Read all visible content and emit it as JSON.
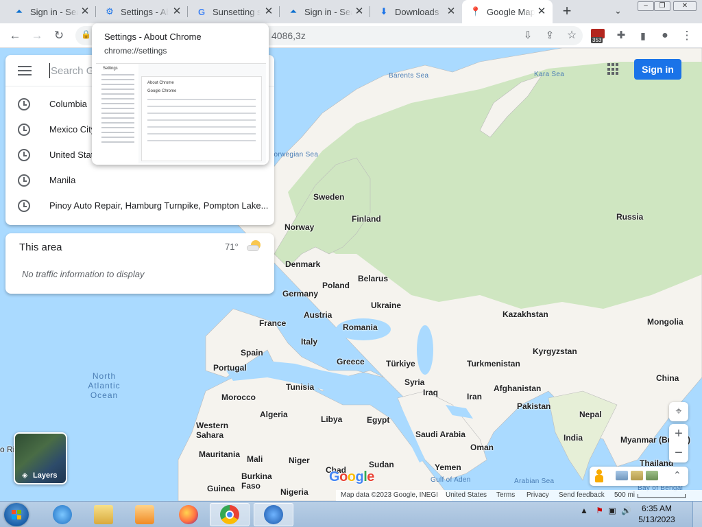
{
  "browser": {
    "tabs": [
      {
        "title": "Sign in - Sea",
        "icon": "azure-icon"
      },
      {
        "title": "Settings - Ab",
        "icon": "settings-gear-icon"
      },
      {
        "title": "Sunsetting su",
        "icon": "google-icon"
      },
      {
        "title": "Sign in - Sea",
        "icon": "azure-icon"
      },
      {
        "title": "Downloads",
        "icon": "download-icon"
      },
      {
        "title": "Google Map",
        "icon": "google-maps-icon"
      }
    ],
    "omnibox_url_fragment": "4086,3z",
    "extension_badge": "353"
  },
  "hovercard": {
    "title": "Settings - About Chrome",
    "url": "chrome://settings",
    "preview_heading": "Settings",
    "preview_section": "About Chrome",
    "preview_product": "Google Chrome"
  },
  "maps": {
    "search_placeholder": "Search Google Maps",
    "history": [
      "Columbia",
      "Mexico City",
      "United States",
      "Manila",
      "Pinoy Auto Repair, Hamburg Turnpike, Pompton Lake..."
    ],
    "area": {
      "title": "This area",
      "temperature": "71°",
      "message": "No traffic information to display"
    },
    "signin_label": "Sign in",
    "layers_label": "Layers",
    "logo": "Google",
    "attribution": {
      "data": "Map data ©2023 Google, INEGI",
      "region": "United States",
      "terms": "Terms",
      "privacy": "Privacy",
      "feedback": "Send feedback",
      "scale": "500 mi"
    },
    "places": {
      "russia": "Russia",
      "sweden": "Sweden",
      "finland": "Finland",
      "norway": "Norway",
      "denmark": "Denmark",
      "poland": "Poland",
      "belarus": "Belarus",
      "germany": "Germany",
      "ukraine": "Ukraine",
      "france": "France",
      "austria": "Austria",
      "romania": "Romania",
      "kazakhstan": "Kazakhstan",
      "mongolia": "Mongolia",
      "italy": "Italy",
      "spain": "Spain",
      "portugal": "Portugal",
      "greece": "Greece",
      "turkiye": "Türkiye",
      "turkmenistan": "Turkmenistan",
      "kyrgyzstan": "Kyrgyzstan",
      "china": "China",
      "syria": "Syria",
      "iraq": "Iraq",
      "iran": "Iran",
      "afghanistan": "Afghanistan",
      "pakistan": "Pakistan",
      "nepal": "Nepal",
      "india": "India",
      "myanmar": "Myanmar (Burma)",
      "thailand": "Thailand",
      "tunisia": "Tunisia",
      "morocco": "Morocco",
      "algeria": "Algeria",
      "libya": "Libya",
      "egypt": "Egypt",
      "saudi": "Saudi Arabia",
      "oman": "Oman",
      "yemen": "Yemen",
      "western_sahara": "Western Sahara",
      "mauritania": "Mauritania",
      "mali": "Mali",
      "niger": "Niger",
      "chad": "Chad",
      "sudan": "Sudan",
      "burkina": "Burkina Faso",
      "guinea": "Guinea",
      "nigeria": "Nigeria"
    },
    "seas": {
      "barents": "Barents Sea",
      "kara": "Kara Sea",
      "norwegian": "Norwegian Sea",
      "arabian": "Arabian Sea",
      "aden": "Gulf of Aden",
      "bengal": "Bay of Bengal",
      "north_atlantic": "North Atlantic Ocean",
      "rio": "o Rio"
    }
  },
  "taskbar": {
    "time": "6:35 AM",
    "date": "5/13/2023"
  },
  "colors": {
    "water": "#aadaff",
    "land": "#f5f3ee",
    "vegetation": "#cfe6c1",
    "accent": "#1a73e8"
  }
}
